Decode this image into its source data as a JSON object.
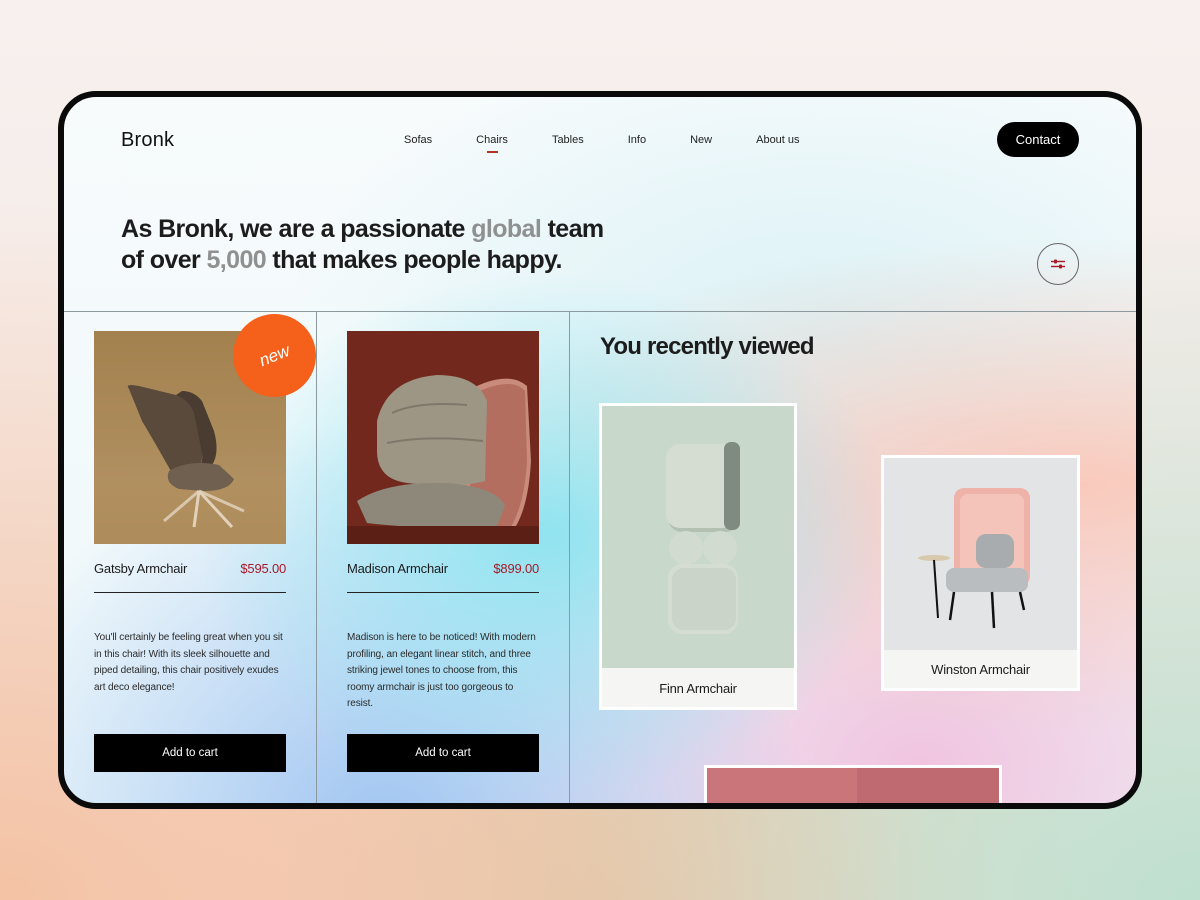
{
  "header": {
    "logo": "Bronk",
    "nav": [
      {
        "label": "Sofas",
        "active": false
      },
      {
        "label": "Chairs",
        "active": true
      },
      {
        "label": "Tables",
        "active": false
      },
      {
        "label": "Info",
        "active": false
      },
      {
        "label": "New",
        "active": false
      },
      {
        "label": "About us",
        "active": false
      }
    ],
    "contact_label": "Contact"
  },
  "hero": {
    "line1_a": "As Bronk, we are a passionate ",
    "line1_muted": "global",
    "line1_b": " team",
    "line2_a": "of over ",
    "line2_muted": "5,000",
    "line2_b": " that makes people happy."
  },
  "products": [
    {
      "name": "Gatsby Armchair",
      "price": "$595.00",
      "badge": "new",
      "description": "You'll certainly be feeling great when you sit in this chair!  With its sleek silhouette and piped detailing, this chair positively exudes art deco elegance!",
      "cta": "Add to cart"
    },
    {
      "name": "Madison Armchair",
      "price": "$899.00",
      "description": "Madison is here to be noticed! With modern profiling, an elegant linear stitch, and three striking jewel tones to choose from, this roomy armchair is just too gorgeous to resist.",
      "cta": "Add to cart"
    }
  ],
  "recently_viewed": {
    "title": "You recently viewed",
    "items": [
      {
        "name": "Finn Armchair"
      },
      {
        "name": "Winston Armchair"
      }
    ]
  },
  "colors": {
    "accent": "#b43020",
    "badge": "#f5601a",
    "price": "#a8192a"
  },
  "icons": {
    "filter": "sliders-icon"
  }
}
